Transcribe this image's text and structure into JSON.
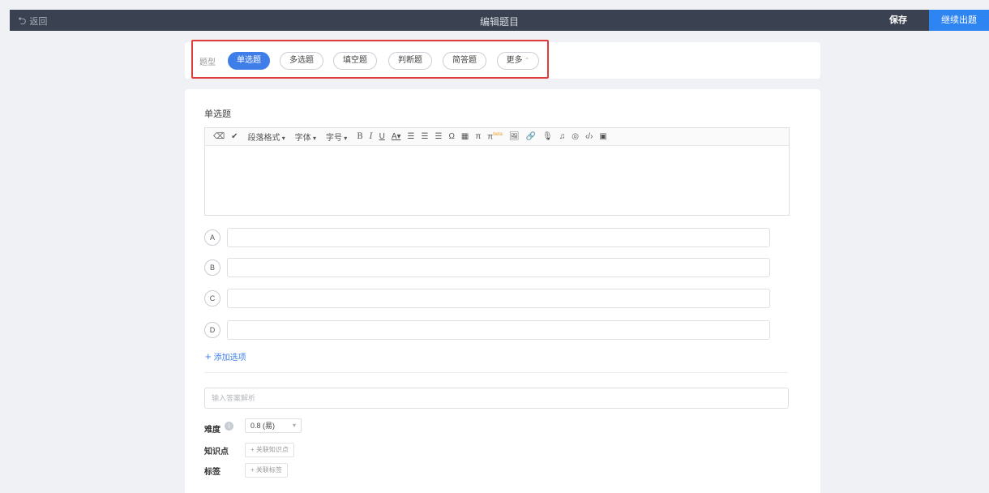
{
  "topbar": {
    "back_label": "返回",
    "title": "编辑题目",
    "save_label": "保存",
    "continue_label": "继续出题"
  },
  "question_type": {
    "label": "题型",
    "options": [
      "单选题",
      "多选题",
      "填空题",
      "判断题",
      "简答题",
      "更多"
    ],
    "selected": "单选题"
  },
  "editor": {
    "section_title": "单选题",
    "toolbar": {
      "paragraph": "段落格式",
      "font": "字体",
      "size": "字号"
    }
  },
  "choices": [
    "A",
    "B",
    "C",
    "D"
  ],
  "add_option_label": "添加选项",
  "analysis_placeholder": "输入答案解析",
  "meta": {
    "difficulty_label": "难度",
    "difficulty_value": "0.8 (易)",
    "knowledge_label": "知识点",
    "knowledge_button": "关联知识点",
    "tag_label": "标签",
    "tag_button": "关联标签"
  },
  "colors": {
    "topbar": "#3a4150",
    "accent": "#3f7ee8",
    "highlight": "#e23b3b"
  }
}
